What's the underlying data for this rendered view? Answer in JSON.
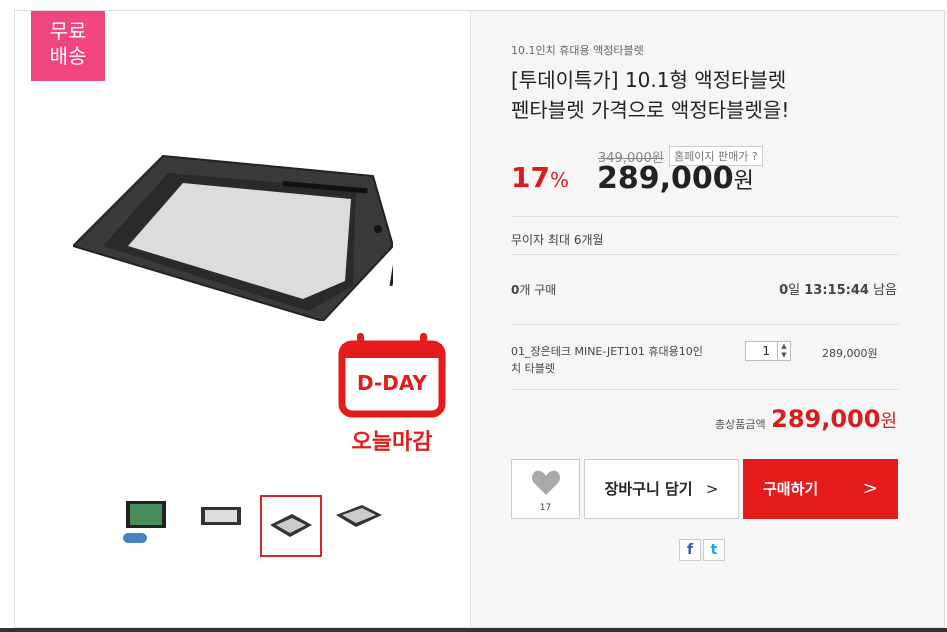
{
  "badge": {
    "line1": "무료",
    "line2": "배송"
  },
  "dday": {
    "label": "D-DAY",
    "caption": "오늘마감"
  },
  "product": {
    "subtitle": "10.1인치 휴대용 액정타블렛",
    "title_line1": "[투데이특가] 10.1형 액정타블렛",
    "title_line2": "펜타블렛 가격으로 액정타블렛을!",
    "original_price": "349,000원",
    "compare_label": "홈페이지 판매가 ?",
    "discount_value": "17",
    "discount_unit": "%",
    "price_value": "289,000",
    "price_unit": "원"
  },
  "installment": "무이자 최대 6개월",
  "sales": {
    "count": "0",
    "count_suffix": "개 구매",
    "days": "0",
    "days_suffix": "일",
    "time": "13:15:44",
    "time_suffix": "남음"
  },
  "option": {
    "name": "01_장은테크 MINE-JET101 휴대용10인치 타블렛",
    "quantity": "1",
    "price": "289,000원"
  },
  "total": {
    "label": "총상품금액",
    "value": "289,000",
    "unit": "원"
  },
  "actions": {
    "wish_count": "17",
    "cart_label": "장바구니 담기",
    "cart_arrow": ">",
    "buy_label": "구매하기",
    "buy_arrow": ">"
  },
  "social": {
    "facebook": "f",
    "twitter": "t"
  },
  "colors": {
    "badge": "#f0457e",
    "accent": "#e31b1b",
    "discount": "#d71d1d"
  }
}
